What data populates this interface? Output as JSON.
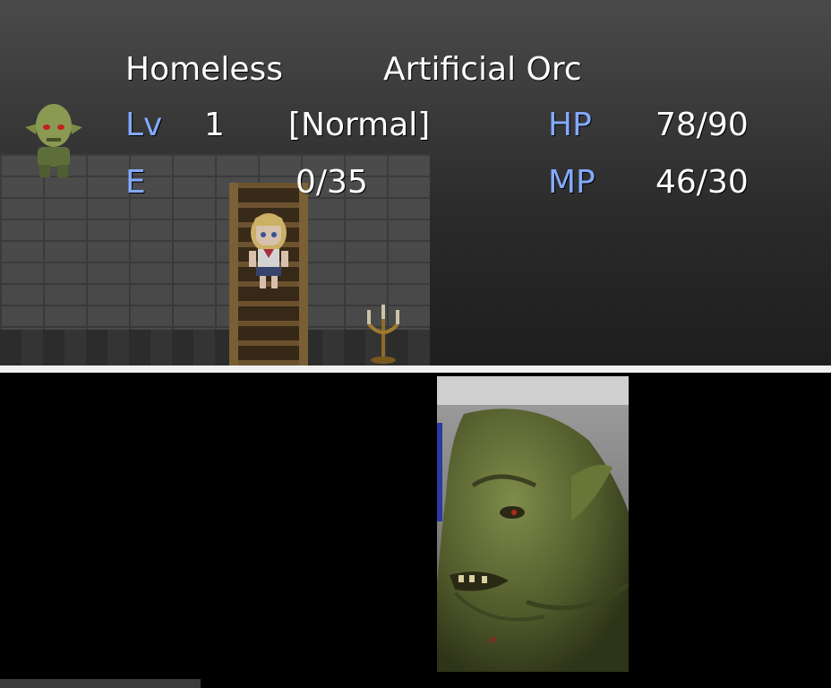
{
  "character": {
    "name": "Homeless",
    "class": "Artificial Orc",
    "level_label": "Lv",
    "level": "1",
    "state": "[Normal]",
    "exp_label": "E",
    "exp_value": "0/35",
    "hp_label": "HP",
    "hp_value": "78/90",
    "mp_label": "MP",
    "mp_value": "46/30"
  },
  "colors": {
    "text": "#ffffff",
    "system_label": "#84aaff",
    "orc_skin": "#6e7d3e"
  },
  "icons": {
    "face": "orc-face-sprite",
    "portrait": "orc-portrait",
    "npc": "schoolgirl-sprite",
    "prop": "candelabra"
  }
}
